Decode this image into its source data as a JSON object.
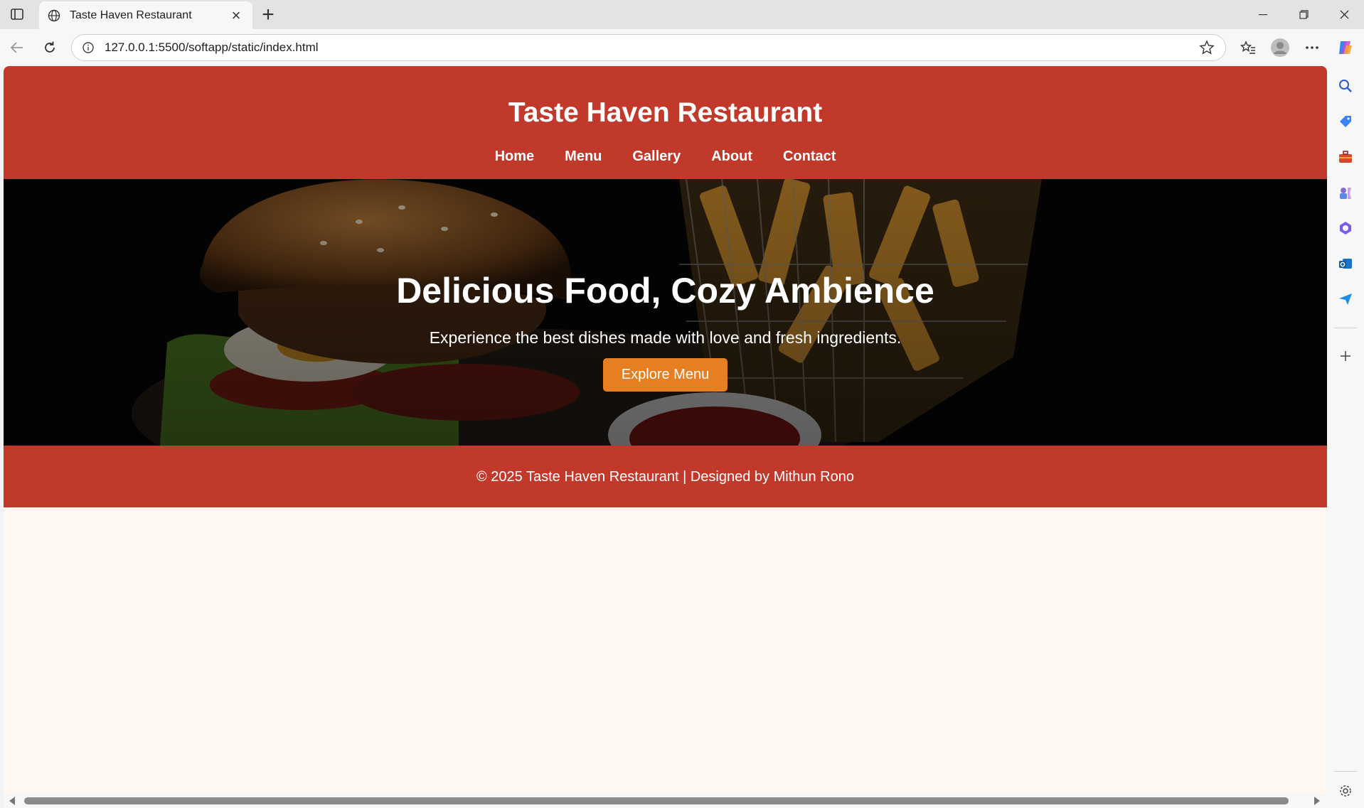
{
  "browser": {
    "tab_title": "Taste Haven Restaurant",
    "new_tab_symbol": "+",
    "close_symbol": "×",
    "url": "127.0.0.1:5500/softapp/static/index.html"
  },
  "site": {
    "title": "Taste Haven Restaurant",
    "nav": [
      "Home",
      "Menu",
      "Gallery",
      "About",
      "Contact"
    ],
    "hero": {
      "title": "Delicious Food, Cozy Ambience",
      "subtitle": "Experience the best dishes made with love and fresh ingredients.",
      "button": "Explore Menu"
    },
    "footer": "© 2025 Taste Haven Restaurant | Designed by Mithun Rono"
  },
  "colors": {
    "brand_red": "#c0392b",
    "accent_orange": "#e67e22",
    "page_bg": "#fff7f0"
  },
  "icons": {
    "sidebar": [
      "search-icon",
      "tag-icon",
      "toolbox-icon",
      "games-icon",
      "copilot-apps-icon",
      "outlook-icon",
      "send-icon",
      "add-icon",
      "settings-icon"
    ]
  }
}
